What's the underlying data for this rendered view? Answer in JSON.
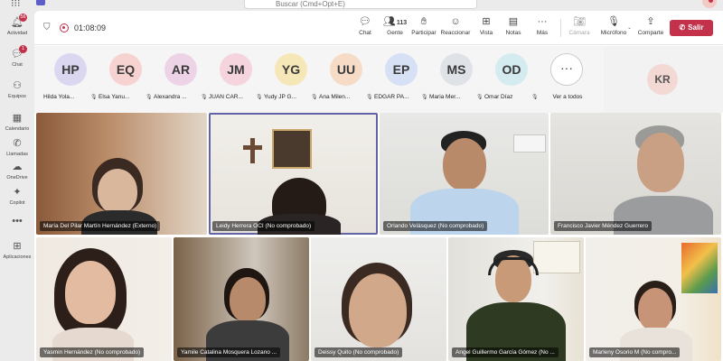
{
  "search": {
    "placeholder": "Buscar (Cmd+Opt+E)"
  },
  "rail": {
    "items": [
      {
        "label": "Actividad",
        "badge": "56",
        "icon": "bell-icon"
      },
      {
        "label": "Chat",
        "badge": "1",
        "icon": "chat-icon"
      },
      {
        "label": "Equipos",
        "badge": "",
        "icon": "teams-icon"
      },
      {
        "label": "Calendario",
        "badge": "",
        "icon": "calendar-icon"
      },
      {
        "label": "Llamadas",
        "badge": "",
        "icon": "phone-icon"
      },
      {
        "label": "OneDrive",
        "badge": "",
        "icon": "cloud-icon"
      },
      {
        "label": "Copilot",
        "badge": "",
        "icon": "copilot-icon"
      },
      {
        "label": "Aplicaciones",
        "badge": "",
        "icon": "apps-icon"
      }
    ]
  },
  "meeting": {
    "timer": "01:08:09",
    "people_count": "113"
  },
  "toolbar": {
    "chat": "Chat",
    "people": "Gente",
    "raise": "Participar",
    "react": "Reaccionar",
    "view": "Vista",
    "notes": "Notas",
    "more": "Más",
    "camera": "Cámara",
    "mic": "Micrófono",
    "share": "Comparte",
    "leave": "Salir"
  },
  "strip": {
    "participants": [
      {
        "initials": "HP",
        "name": "Hilda Yola...",
        "color": "#dcd7f1"
      },
      {
        "initials": "EQ",
        "name": "Elsa Yanu...",
        "color": "#f6d3d0"
      },
      {
        "initials": "AR",
        "name": "Alexandra ...",
        "color": "#edd3e6"
      },
      {
        "initials": "JM",
        "name": "JUAN CAR...",
        "color": "#f5d4de"
      },
      {
        "initials": "YG",
        "name": "Yudy JP G...",
        "color": "#f6e7b9"
      },
      {
        "initials": "UU",
        "name": "Ana Milen...",
        "color": "#f6dcc6"
      },
      {
        "initials": "EP",
        "name": "EDGAR PA...",
        "color": "#d6e1f5"
      },
      {
        "initials": "MS",
        "name": "Maria Mer...",
        "color": "#dfe3e8"
      },
      {
        "initials": "OD",
        "name": "Omar Díaz",
        "color": "#d4ecf0"
      }
    ],
    "more_label": "Ver a todos",
    "self_initials": "KR"
  },
  "videos": [
    {
      "name": "María Del Pilar Martín Hernández (Externo)"
    },
    {
      "name": "Leidy Herrera OCI (No comprobado)"
    },
    {
      "name": "Orlando Velásquez (No comprobado)"
    },
    {
      "name": "Francisco Javier Méndez Guerrero"
    },
    {
      "name": "Yasmin Hernández (No comprobado)"
    },
    {
      "name": "Yamile Catalina Mosquera Lozano ..."
    },
    {
      "name": "Deissy Quito (No comprobado)"
    },
    {
      "name": "Angel Guillermo García Gómez (No ..."
    },
    {
      "name": "Marleny Osorio M (No compro..."
    }
  ]
}
